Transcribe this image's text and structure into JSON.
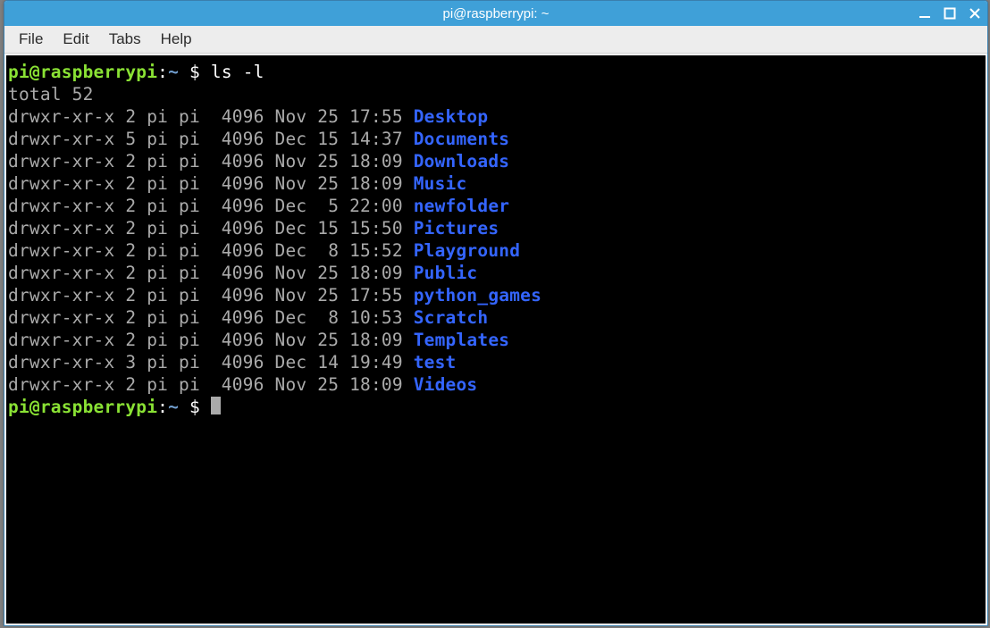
{
  "window": {
    "title": "pi@raspberrypi: ~"
  },
  "menubar": {
    "items": [
      "File",
      "Edit",
      "Tabs",
      "Help"
    ]
  },
  "prompt": {
    "user_host": "pi@raspberrypi",
    "colon": ":",
    "path": "~",
    "symbol": " $ "
  },
  "command": "ls -l",
  "total_line": "total 52",
  "listing": [
    {
      "perms": "drwxr-xr-x",
      "links": "2",
      "owner": "pi",
      "group": "pi",
      "size": "4096",
      "month": "Nov",
      "day": "25",
      "time": "17:55",
      "name": "Desktop"
    },
    {
      "perms": "drwxr-xr-x",
      "links": "5",
      "owner": "pi",
      "group": "pi",
      "size": "4096",
      "month": "Dec",
      "day": "15",
      "time": "14:37",
      "name": "Documents"
    },
    {
      "perms": "drwxr-xr-x",
      "links": "2",
      "owner": "pi",
      "group": "pi",
      "size": "4096",
      "month": "Nov",
      "day": "25",
      "time": "18:09",
      "name": "Downloads"
    },
    {
      "perms": "drwxr-xr-x",
      "links": "2",
      "owner": "pi",
      "group": "pi",
      "size": "4096",
      "month": "Nov",
      "day": "25",
      "time": "18:09",
      "name": "Music"
    },
    {
      "perms": "drwxr-xr-x",
      "links": "2",
      "owner": "pi",
      "group": "pi",
      "size": "4096",
      "month": "Dec",
      "day": " 5",
      "time": "22:00",
      "name": "newfolder"
    },
    {
      "perms": "drwxr-xr-x",
      "links": "2",
      "owner": "pi",
      "group": "pi",
      "size": "4096",
      "month": "Dec",
      "day": "15",
      "time": "15:50",
      "name": "Pictures"
    },
    {
      "perms": "drwxr-xr-x",
      "links": "2",
      "owner": "pi",
      "group": "pi",
      "size": "4096",
      "month": "Dec",
      "day": " 8",
      "time": "15:52",
      "name": "Playground"
    },
    {
      "perms": "drwxr-xr-x",
      "links": "2",
      "owner": "pi",
      "group": "pi",
      "size": "4096",
      "month": "Nov",
      "day": "25",
      "time": "18:09",
      "name": "Public"
    },
    {
      "perms": "drwxr-xr-x",
      "links": "2",
      "owner": "pi",
      "group": "pi",
      "size": "4096",
      "month": "Nov",
      "day": "25",
      "time": "17:55",
      "name": "python_games"
    },
    {
      "perms": "drwxr-xr-x",
      "links": "2",
      "owner": "pi",
      "group": "pi",
      "size": "4096",
      "month": "Dec",
      "day": " 8",
      "time": "10:53",
      "name": "Scratch"
    },
    {
      "perms": "drwxr-xr-x",
      "links": "2",
      "owner": "pi",
      "group": "pi",
      "size": "4096",
      "month": "Nov",
      "day": "25",
      "time": "18:09",
      "name": "Templates"
    },
    {
      "perms": "drwxr-xr-x",
      "links": "3",
      "owner": "pi",
      "group": "pi",
      "size": "4096",
      "month": "Dec",
      "day": "14",
      "time": "19:49",
      "name": "test"
    },
    {
      "perms": "drwxr-xr-x",
      "links": "2",
      "owner": "pi",
      "group": "pi",
      "size": "4096",
      "month": "Nov",
      "day": "25",
      "time": "18:09",
      "name": "Videos"
    }
  ]
}
